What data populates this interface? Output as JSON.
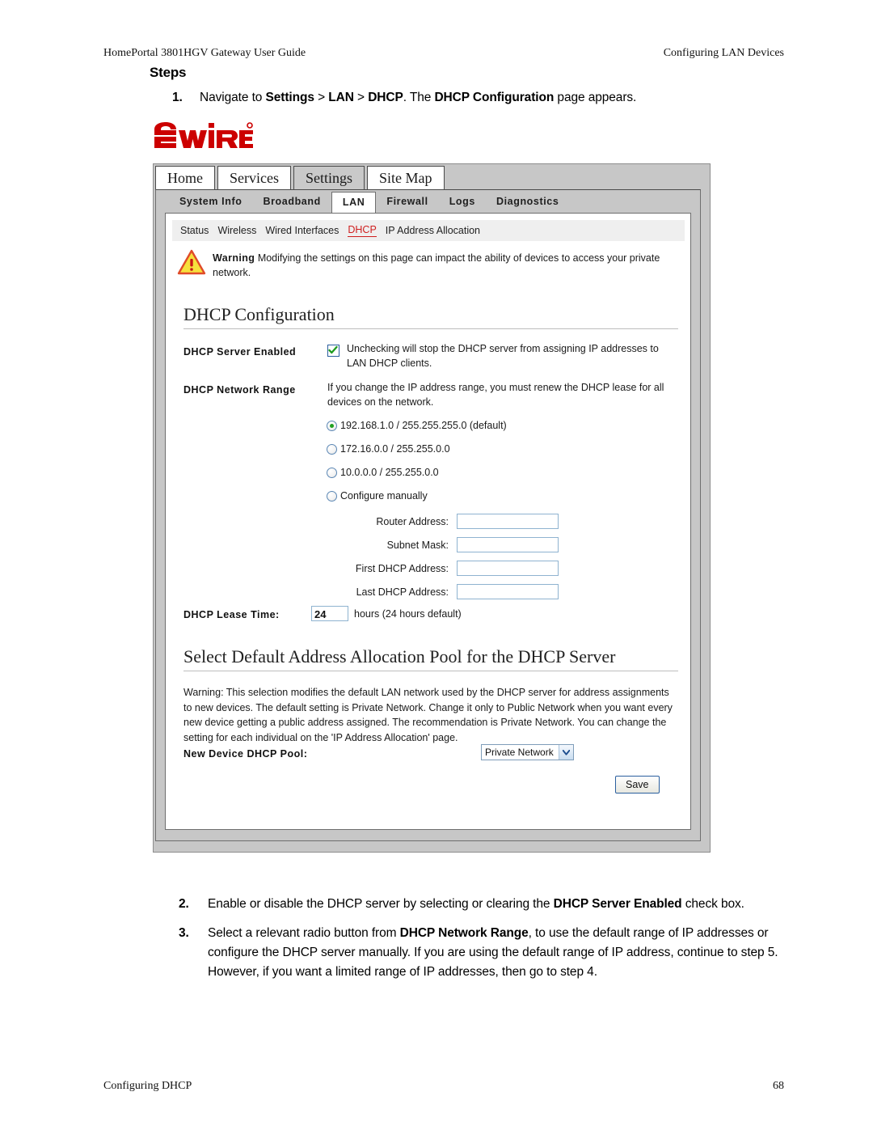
{
  "document": {
    "header_left": "HomePortal 3801HGV Gateway User Guide",
    "header_right": "Configuring LAN Devices",
    "footer_left": "Configuring DHCP",
    "footer_right": "68",
    "steps_heading": "Steps",
    "step1": {
      "number": "1.",
      "text_a": "Navigate to ",
      "bold_a": "Settings",
      "text_b": " > ",
      "bold_b": "LAN",
      "text_c": " > ",
      "bold_c": "DHCP",
      "text_d": ". The ",
      "bold_d": "DHCP Configuration",
      "text_e": " page appears."
    },
    "step2": {
      "number": "2.",
      "text_a": "Enable or disable the DHCP server by selecting or clearing the ",
      "bold_a": "DHCP Server Enabled",
      "text_b": " check box."
    },
    "step3": {
      "number": "3.",
      "text_a": "Select a relevant radio button from ",
      "bold_a": "DHCP Network Range",
      "text_b": ", to use the default range of IP addresses or configure the DHCP server manually. If you are using the default range of IP address, continue to step 5. However, if you want a limited range of IP addresses, then go to step 4."
    }
  },
  "screenshot": {
    "logo": {
      "name": "2WIRE",
      "color": "#cc0000"
    },
    "main_tabs": [
      {
        "label": "Home",
        "active": false
      },
      {
        "label": "Services",
        "active": false
      },
      {
        "label": "Settings",
        "active": true
      },
      {
        "label": "Site Map",
        "active": false
      }
    ],
    "sub_tabs": [
      {
        "label": "System Info",
        "active": false
      },
      {
        "label": "Broadband",
        "active": false
      },
      {
        "label": "LAN",
        "active": true
      },
      {
        "label": "Firewall",
        "active": false
      },
      {
        "label": "Logs",
        "active": false
      },
      {
        "label": "Diagnostics",
        "active": false
      }
    ],
    "nav3": [
      {
        "label": "Status",
        "current": false
      },
      {
        "label": "Wireless",
        "current": false
      },
      {
        "label": "Wired Interfaces",
        "current": false
      },
      {
        "label": "DHCP",
        "current": true
      },
      {
        "label": "IP Address Allocation",
        "current": false
      }
    ],
    "nav3_accent": "#cf1f1f",
    "warning_banner": {
      "icon": "warning-triangle-icon",
      "bold": "Warning",
      "text": " Modifying the settings on this page can impact the ability of devices to access your private network."
    },
    "section1": {
      "title": "DHCP Configuration",
      "server_enabled": {
        "label": "DHCP Server Enabled",
        "checked": true,
        "description": "Unchecking will stop the DHCP server from assigning IP addresses to LAN DHCP clients."
      },
      "network_range": {
        "label": "DHCP Network Range",
        "description": "If you change the IP address range, you must renew the DHCP lease for all devices on the network.",
        "options": [
          {
            "label": "192.168.1.0 / 255.255.255.0 (default)",
            "selected": true
          },
          {
            "label": "172.16.0.0 / 255.255.0.0",
            "selected": false
          },
          {
            "label": "10.0.0.0 / 255.255.0.0",
            "selected": false
          },
          {
            "label": "Configure manually",
            "selected": false
          }
        ]
      },
      "manual_fields": [
        {
          "label": "Router Address:",
          "value": ""
        },
        {
          "label": "Subnet Mask:",
          "value": ""
        },
        {
          "label": "First DHCP Address:",
          "value": ""
        },
        {
          "label": "Last DHCP Address:",
          "value": ""
        }
      ],
      "lease_time": {
        "label": "DHCP Lease Time:",
        "value": "24",
        "suffix": "hours (24 hours default)"
      }
    },
    "section2": {
      "title": "Select Default Address Allocation Pool for the DHCP Server",
      "warning_paragraph": "Warning: This selection modifies the default LAN network used by the DHCP server for address assignments to new devices. The default setting is Private Network. Change it only to Public Network when you want every new device getting a public address assigned. The recommendation is Private Network. You can change the setting for each individual on the 'IP Address Allocation' page.",
      "pool": {
        "label": "New Device DHCP Pool:",
        "selected": "Private Network"
      },
      "save_button": "Save"
    }
  }
}
